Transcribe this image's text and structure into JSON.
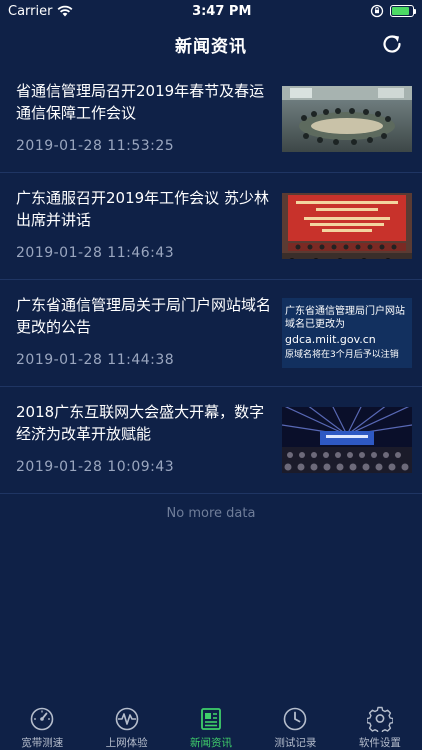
{
  "status_bar": {
    "carrier": "Carrier",
    "time": "3:47 PM",
    "battery_level": 0.85
  },
  "nav": {
    "title": "新闻资讯",
    "refresh_icon": "refresh-icon"
  },
  "news": [
    {
      "title": "省通信管理局召开2019年春节及春运通信保障工作会议",
      "time": "2019-01-28 11:53:25"
    },
    {
      "title": "广东通服召开2019年工作会议 苏少林出席并讲话",
      "time": "2019-01-28 11:46:43"
    },
    {
      "title": "广东省通信管理局关于局门户网站域名更改的公告",
      "time": "2019-01-28 11:44:38",
      "thumb_text": {
        "line1": "广东省通信管理局门户网站",
        "line2": "域名已更改为",
        "domain": "gdca.miit.gov.cn",
        "line3": "原域名将在3个月后予以注销"
      }
    },
    {
      "title": "2018广东互联网大会盛大开幕，数字经济为改革开放赋能",
      "time": "2019-01-28 10:09:43"
    }
  ],
  "no_more": "No more data",
  "tabs": [
    {
      "label": "宽带测速",
      "icon": "speedometer-icon",
      "active": false
    },
    {
      "label": "上网体验",
      "icon": "pulse-icon",
      "active": false
    },
    {
      "label": "新闻资讯",
      "icon": "newspaper-icon",
      "active": true
    },
    {
      "label": "测试记录",
      "icon": "clock-icon",
      "active": false
    },
    {
      "label": "软件设置",
      "icon": "gear-icon",
      "active": false
    }
  ],
  "colors": {
    "background": "#0f2147",
    "active_tab": "#3fcf6a",
    "inactive_tab": "#b5bdcc",
    "time_text": "#9aa6bf"
  }
}
